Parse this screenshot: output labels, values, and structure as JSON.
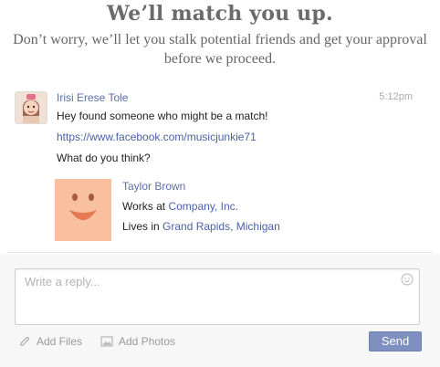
{
  "header": {
    "title": "We’ll match you up.",
    "subtitle": "Don’t worry, we’ll let you stalk potential friends and get your approval before we proceed."
  },
  "message": {
    "sender": "Irisi Erese Tole",
    "time": "5:12pm",
    "lines": [
      "Hey found someone who might be a match!",
      "https://www.facebook.com/musicjunkie71",
      "What do you think?"
    ]
  },
  "card": {
    "name": "Taylor Brown",
    "works_prefix": "Works at",
    "company": "Company, Inc.",
    "lives_prefix": "Lives in",
    "location": "Grand Rapids, Michigan"
  },
  "reply": {
    "placeholder": "Write a reply..."
  },
  "actions": {
    "add_files": "Add Files",
    "add_photos": "Add Photos",
    "send": "Send"
  },
  "icons": {
    "smiley": "smiley-icon",
    "paperclip": "paperclip-icon",
    "photo": "photo-icon"
  },
  "colors": {
    "link": "#4a63a8",
    "send": "#7f8fbf",
    "card_face": "#f8c09f"
  }
}
